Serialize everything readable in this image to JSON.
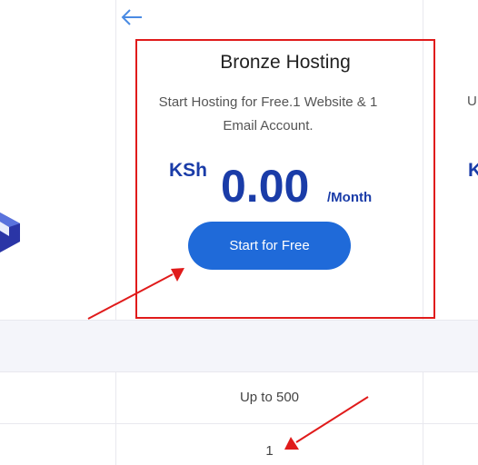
{
  "plan": {
    "title": "Bronze Hosting",
    "description": "Start Hosting for Free.1 Website & 1 Email Account.",
    "currency": "KSh",
    "amount": "0.00",
    "period": "/Month",
    "cta_label": "Start for Free"
  },
  "next_plan": {
    "description_partial": "U",
    "currency_partial": "K"
  },
  "rows": [
    {
      "value": "Up to 500"
    },
    {
      "value": "1"
    }
  ],
  "icons": {
    "back": "arrow-left-icon",
    "illustration": "isometric-shape-icon"
  },
  "colors": {
    "accent_blue": "#1f6ad9",
    "price_blue": "#1a3ca8",
    "annotation_red": "#e01b1b",
    "band_background": "#f4f5fa"
  }
}
